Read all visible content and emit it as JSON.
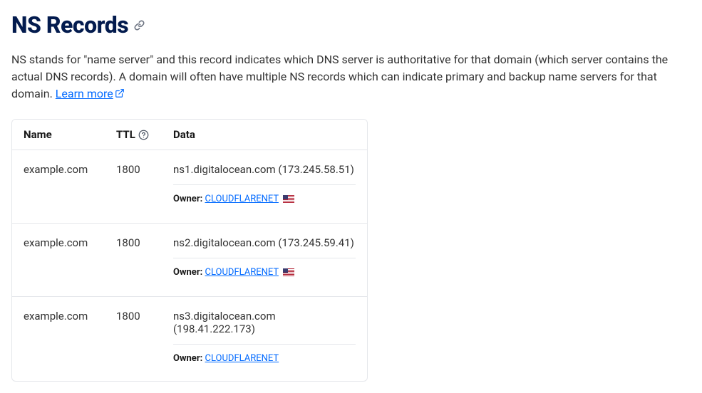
{
  "heading": "NS Records",
  "description_prefix": "NS stands for \"name server\" and this record indicates which DNS server is authoritative for that domain (which server contains the actual DNS records). A domain will often have multiple NS records which can indicate primary and backup name servers for that domain. ",
  "learn_more_label": "Learn more",
  "columns": {
    "name": "Name",
    "ttl": "TTL",
    "data": "Data"
  },
  "owner_label": "Owner:",
  "rows": [
    {
      "name": "example.com",
      "ttl": "1800",
      "data": "ns1.digitalocean.com (173.245.58.51)",
      "owner_link": "CLOUDFLARENET",
      "has_flag": true
    },
    {
      "name": "example.com",
      "ttl": "1800",
      "data": "ns2.digitalocean.com (173.245.59.41)",
      "owner_link": "CLOUDFLARENET",
      "has_flag": true
    },
    {
      "name": "example.com",
      "ttl": "1800",
      "data": "ns3.digitalocean.com (198.41.222.173)",
      "owner_link": "CLOUDFLARENET",
      "has_flag": false
    }
  ]
}
